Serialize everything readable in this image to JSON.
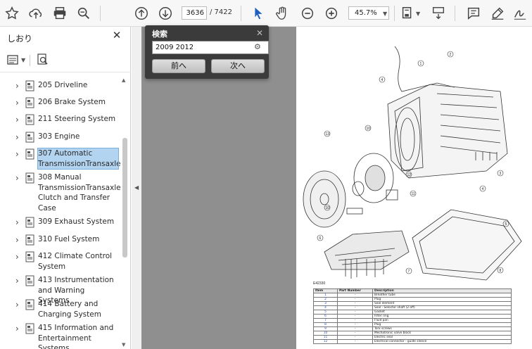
{
  "toolbar": {
    "page_current": "3636",
    "page_total": "/ 7422",
    "zoom": "45.7%"
  },
  "sidebar": {
    "title": "しおり",
    "items": [
      {
        "label": "205 Driveline"
      },
      {
        "label": "206 Brake System"
      },
      {
        "label": "211 Steering System"
      },
      {
        "label": "303 Engine"
      },
      {
        "label": "307 Automatic\nTransmissionTransaxle",
        "selected": true
      },
      {
        "label": "308 Manual\nTransmissionTransaxle,\nClutch and Transfer\nCase"
      },
      {
        "label": "309 Exhaust System"
      },
      {
        "label": "310 Fuel System"
      },
      {
        "label": "412 Climate Control\nSystem"
      },
      {
        "label": "413 Instrumentation\nand Warning Systems"
      },
      {
        "label": "414 Battery and\nCharging System"
      },
      {
        "label": "415 Information and\nEntertainment Systems"
      }
    ]
  },
  "find": {
    "title": "検索",
    "query": "2009 2012",
    "prev_label": "前へ",
    "next_label": "次へ"
  },
  "document": {
    "figure_id": "E42330",
    "callouts": [
      "1",
      "2",
      "3",
      "4",
      "5",
      "6",
      "7",
      "8",
      "9",
      "10",
      "11",
      "12",
      "13"
    ],
    "table": {
      "headers": [
        "Item",
        "Part Number",
        "Description"
      ],
      "rows": [
        [
          "1",
          "-",
          "Breather tube"
        ],
        [
          "2",
          "-",
          "Plug"
        ],
        [
          "3",
          "-",
          "Seal element"
        ],
        [
          "4",
          "-",
          "Seal - Selector shaft (2 off)"
        ],
        [
          "5",
          "-",
          "Gasket"
        ],
        [
          "6",
          "-",
          "Filter ring"
        ],
        [
          "7",
          "-",
          "Fluid pan"
        ],
        [
          "8",
          "-",
          "Plug"
        ],
        [
          "9",
          "-",
          "Torx screws"
        ],
        [
          "10",
          "-",
          "Mechatronic valve block"
        ],
        [
          "11",
          "-",
          "Electric seal"
        ],
        [
          "12",
          "-",
          "Electrical connector - guide sleeve"
        ]
      ]
    }
  }
}
